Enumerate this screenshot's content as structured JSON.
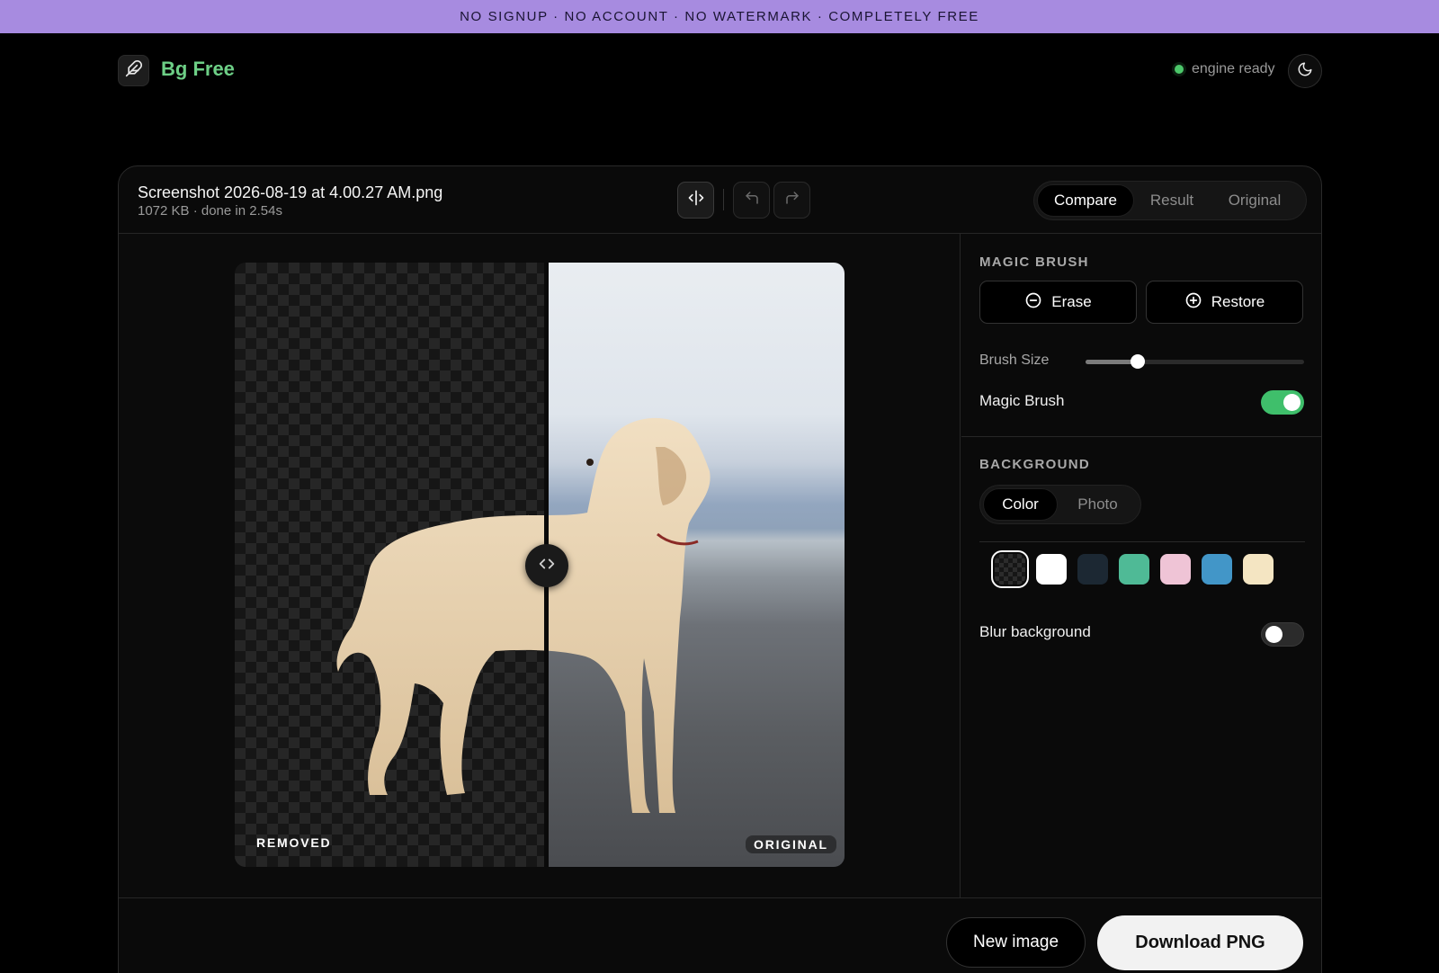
{
  "banner": {
    "text": "NO SIGNUP · NO ACCOUNT · NO WATERMARK · COMPLETELY FREE"
  },
  "header": {
    "brand": "Bg Free",
    "logo_icon": "feather-icon",
    "status_text": "engine ready",
    "status_color": "#4cc76a",
    "theme_icon": "moon-icon"
  },
  "file": {
    "name": "Screenshot 2026-08-19 at 4.00.27 AM.png",
    "meta": "1072 KB · done in 2.54s"
  },
  "toolbar": {
    "split_icon": "split-view-icon",
    "undo_icon": "undo-icon",
    "redo_icon": "redo-icon"
  },
  "view_tabs": [
    {
      "label": "Compare",
      "active": true
    },
    {
      "label": "Result",
      "active": false
    },
    {
      "label": "Original",
      "active": false
    }
  ],
  "preview": {
    "left_label": "REMOVED",
    "right_label": "ORIGINAL",
    "split_position": 0.51
  },
  "magic_brush": {
    "title": "MAGIC BRUSH",
    "erase_label": "Erase",
    "restore_label": "Restore",
    "brush_size_label": "Brush Size",
    "brush_size_value": 0.24,
    "toggle_label": "Magic Brush",
    "toggle_on": true
  },
  "background": {
    "title": "BACKGROUND",
    "tabs": [
      {
        "label": "Color",
        "active": true
      },
      {
        "label": "Photo",
        "active": false
      }
    ],
    "swatches": [
      "transparent",
      "#ffffff",
      "#1c2833",
      "#4fba96",
      "#efc4d6",
      "#4296c8",
      "#f4e5c2"
    ],
    "selected_swatch": "transparent",
    "blur_label": "Blur background",
    "blur_on": false
  },
  "footer": {
    "new_label": "New image",
    "download_label": "Download PNG"
  }
}
